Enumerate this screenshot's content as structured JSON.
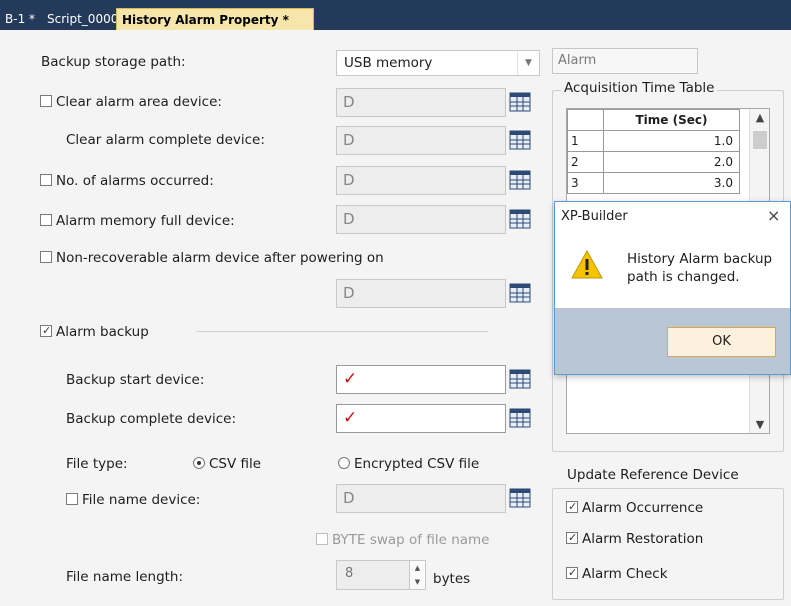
{
  "tabs": [
    {
      "label": "B-1 *"
    },
    {
      "label": "Script_0000"
    },
    {
      "label": "History Alarm Property *"
    }
  ],
  "form": {
    "backup_storage_path": {
      "label": "Backup storage path:",
      "value": "USB memory"
    },
    "alarm_box": "Alarm",
    "clear_alarm_area": {
      "label": "Clear alarm area device:",
      "value": "D"
    },
    "clear_alarm_complete": {
      "label": "Clear alarm complete device:",
      "value": "D"
    },
    "no_alarms": {
      "label": "No. of alarms occurred:",
      "value": "D"
    },
    "memory_full": {
      "label": "Alarm memory full device:",
      "value": "D"
    },
    "non_recoverable": {
      "label": "Non-recoverable alarm device after powering on",
      "value": "D"
    },
    "alarm_backup": {
      "label": "Alarm backup"
    },
    "backup_start": {
      "label": "Backup start device:",
      "value": "✓"
    },
    "backup_complete": {
      "label": "Backup complete device:",
      "value": "✓"
    },
    "file_type": {
      "label": "File type:",
      "option_csv": "CSV file",
      "option_encrypted": "Encrypted CSV file"
    },
    "file_name_device": {
      "label": "File name device:",
      "value": "D"
    },
    "byte_swap": {
      "label": "BYTE swap of file name"
    },
    "file_name_length": {
      "label": "File name length:",
      "value": "8",
      "unit": "bytes"
    }
  },
  "acq_table": {
    "title": "Acquisition Time Table",
    "header": "Time (Sec)",
    "rows": [
      {
        "n": "1",
        "v": "1.0"
      },
      {
        "n": "2",
        "v": "2.0"
      },
      {
        "n": "3",
        "v": "3.0"
      }
    ]
  },
  "update_ref": {
    "title": "Update Reference Device",
    "items": [
      "Alarm Occurrence",
      "Alarm Restoration",
      "Alarm Check"
    ]
  },
  "dialog": {
    "title": "XP-Builder",
    "close": "×",
    "message": "History Alarm backup path is changed.",
    "ok": "OK"
  }
}
